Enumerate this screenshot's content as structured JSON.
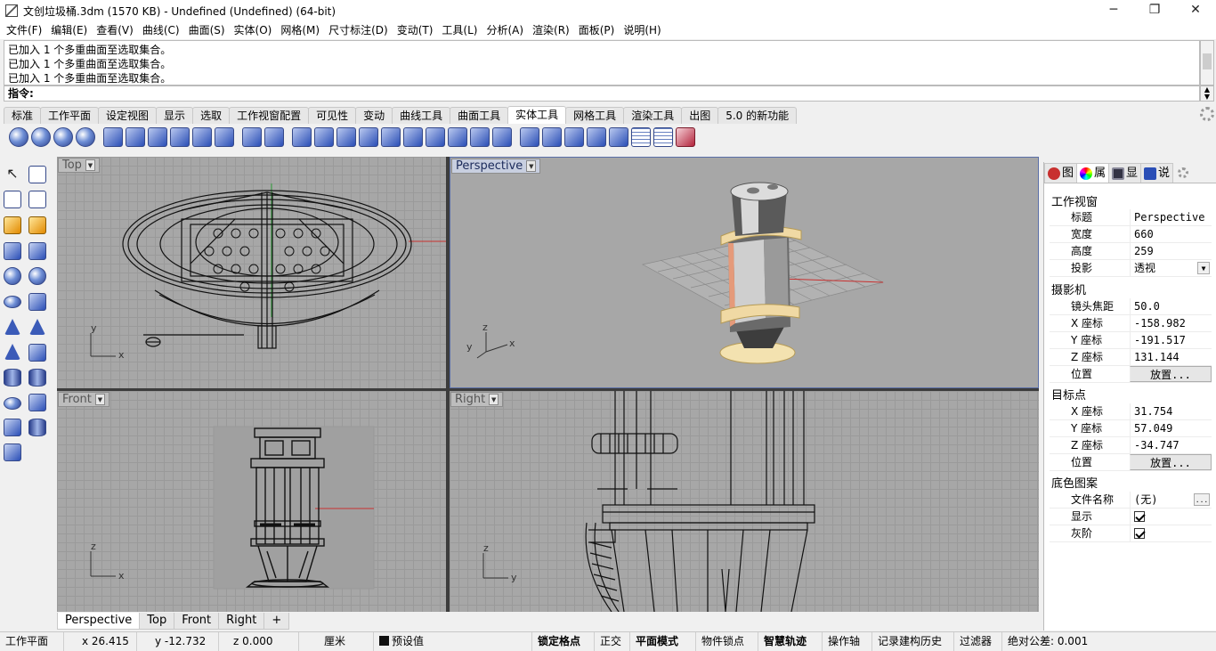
{
  "window": {
    "title": "文创垃圾桶.3dm (1570 KB) - Undefined (Undefined) (64-bit)",
    "minimize": "─",
    "maximize": "❐",
    "close": "✕"
  },
  "menu": [
    "文件(F)",
    "编辑(E)",
    "查看(V)",
    "曲线(C)",
    "曲面(S)",
    "实体(O)",
    "网格(M)",
    "尺寸标注(D)",
    "变动(T)",
    "工具(L)",
    "分析(A)",
    "渲染(R)",
    "面板(P)",
    "说明(H)"
  ],
  "command": {
    "history": [
      "已加入 1 个多重曲面至选取集合。",
      "已加入 1 个多重曲面至选取集合。",
      "已加入 1 个多重曲面至选取集合。"
    ],
    "prompt": "指令:",
    "value": ""
  },
  "toolbar_tabs": [
    "标准",
    "工作平面",
    "设定视图",
    "显示",
    "选取",
    "工作视窗配置",
    "可见性",
    "变动",
    "曲线工具",
    "曲面工具",
    "实体工具",
    "网格工具",
    "渲染工具",
    "出图",
    "5.0 的新功能"
  ],
  "toolbar_active_tab": "实体工具",
  "viewports": {
    "top": {
      "label": "Top"
    },
    "perspective": {
      "label": "Perspective"
    },
    "front": {
      "label": "Front"
    },
    "right": {
      "label": "Right"
    },
    "axis": {
      "x": "x",
      "y": "y",
      "z": "z"
    }
  },
  "viewport_tabs": [
    "Perspective",
    "Top",
    "Front",
    "Right",
    "+"
  ],
  "panel": {
    "tabs": [
      "图",
      "属",
      "显",
      "说"
    ],
    "section_viewport": "工作视窗",
    "title_label": "标题",
    "title_value": "Perspective",
    "width_label": "宽度",
    "width_value": "660",
    "height_label": "高度",
    "height_value": "259",
    "projection_label": "投影",
    "projection_value": "透视",
    "section_camera": "摄影机",
    "lens_label": "镜头焦距",
    "lens_value": "50.0",
    "cam_x_label": "X 座标",
    "cam_x_value": "-158.982",
    "cam_y_label": "Y 座标",
    "cam_y_value": "-191.517",
    "cam_z_label": "Z 座标",
    "cam_z_value": "131.144",
    "cam_pos_label": "位置",
    "cam_pos_button": "放置...",
    "section_target": "目标点",
    "tgt_x_label": "X 座标",
    "tgt_x_value": "31.754",
    "tgt_y_label": "Y 座标",
    "tgt_y_value": "57.049",
    "tgt_z_label": "Z 座标",
    "tgt_z_value": "-34.747",
    "tgt_pos_label": "位置",
    "tgt_pos_button": "放置...",
    "section_bg": "底色图案",
    "file_label": "文件名称",
    "file_value": "(无)",
    "file_button": "...",
    "show_label": "显示",
    "show_checked": true,
    "gray_label": "灰阶",
    "gray_checked": true
  },
  "status": {
    "cplane": "工作平面",
    "x": "x 26.415",
    "y": "y -12.732",
    "z": "z 0.000",
    "unit": "厘米",
    "layer": "预设值",
    "snap": "锁定格点",
    "ortho": "正交",
    "planar": "平面模式",
    "osnap": "物件锁点",
    "smarttrack": "智慧轨迹",
    "gumball": "操作轴",
    "history": "记录建构历史",
    "filter": "过滤器",
    "tolerance": "绝对公差: 0.001"
  },
  "colors": {
    "accent": "#1b2a5a",
    "grid": "#9a9a9a",
    "viewport_bg": "#a7a7a7",
    "x_axis": "#c8302f",
    "y_axis": "#2f9e3a"
  }
}
